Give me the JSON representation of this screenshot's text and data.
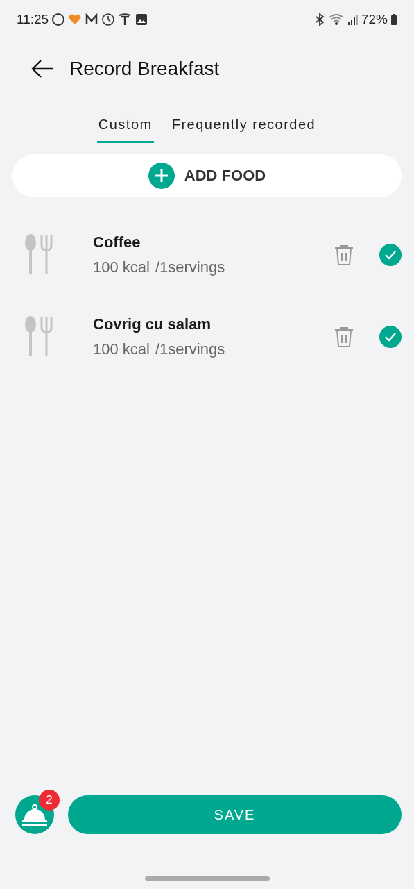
{
  "status_bar": {
    "time": "11:25",
    "battery": "72%"
  },
  "header": {
    "title": "Record Breakfast"
  },
  "tabs": [
    {
      "label": "Custom",
      "selected": true
    },
    {
      "label": "Frequently recorded",
      "selected": false
    }
  ],
  "add_button": {
    "label": "ADD FOOD"
  },
  "foods": [
    {
      "name": "Coffee",
      "kcal": "100 kcal",
      "servings": "/1servings",
      "checked": true
    },
    {
      "name": "Covrig cu salam",
      "kcal": "100 kcal",
      "servings": "/1servings",
      "checked": true
    }
  ],
  "tray": {
    "badge": "2"
  },
  "save_button": {
    "label": "SAVE"
  }
}
